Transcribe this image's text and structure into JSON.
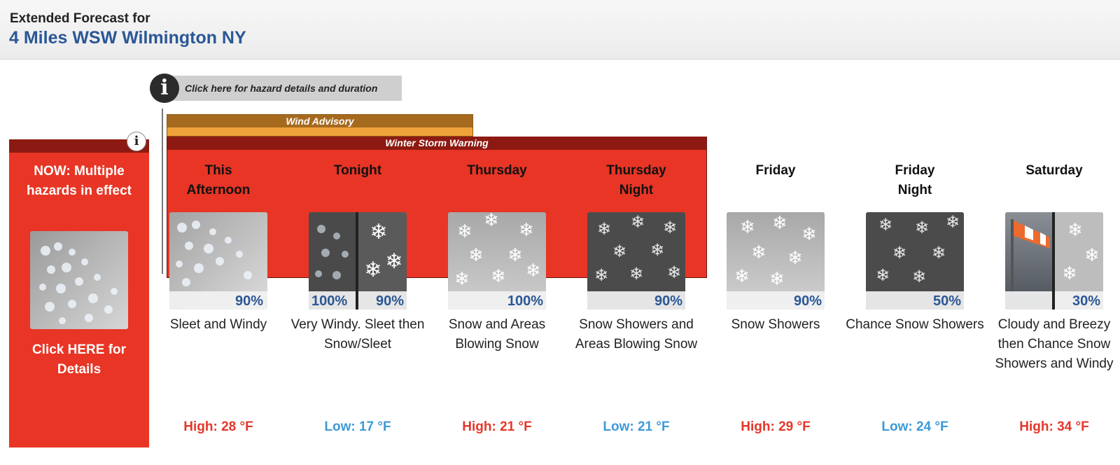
{
  "header": {
    "subtitle": "Extended Forecast for",
    "location": "4 Miles WSW Wilmington NY"
  },
  "hazard_link": {
    "icon": "info-icon",
    "text": "Click here for hazard details and duration"
  },
  "hazards": [
    {
      "name": "Wind Advisory",
      "color": "#f0a23a",
      "label_color": "#a66a1f"
    },
    {
      "name": "Winter Storm Warning",
      "color": "#e83525",
      "label_color": "#8d1a12"
    }
  ],
  "now_box": {
    "icon": "info-icon",
    "text": "NOW: Multiple hazards in effect",
    "link": "Click HERE for Details",
    "image": "sleet-icon"
  },
  "periods": [
    {
      "name": "This Afternoon",
      "pop": [
        "90%"
      ],
      "image": "sleet-icon",
      "description": "Sleet and Windy",
      "temp": "High: 28 °F",
      "type": "high"
    },
    {
      "name": "Tonight",
      "pop": [
        "100%",
        "90%"
      ],
      "image": "sleet-then-snow-icon",
      "description": "Very Windy. Sleet then Snow/Sleet",
      "temp": "Low: 17 °F",
      "type": "low"
    },
    {
      "name": "Thursday",
      "pop": [
        "100%"
      ],
      "image": "snow-icon",
      "description": "Snow and Areas Blowing Snow",
      "temp": "High: 21 °F",
      "type": "high"
    },
    {
      "name": "Thursday Night",
      "pop": [
        "90%"
      ],
      "image": "snow-night-icon",
      "description": "Snow Showers and Areas Blowing Snow",
      "temp": "Low: 21 °F",
      "type": "low"
    },
    {
      "name": "Friday",
      "pop": [
        "90%"
      ],
      "image": "snow-icon",
      "description": "Snow Showers",
      "temp": "High: 29 °F",
      "type": "high"
    },
    {
      "name": "Friday Night",
      "pop": [
        "50%"
      ],
      "image": "snow-night-icon",
      "description": "Chance Snow Showers",
      "temp": "Low: 24 °F",
      "type": "low"
    },
    {
      "name": "Saturday",
      "pop": [
        "30%"
      ],
      "image": "wind-then-snow-icon",
      "description": "Cloudy and Breezy then Chance Snow Showers and Windy",
      "temp": "High: 34 °F",
      "type": "high"
    }
  ],
  "colors": {
    "high": "#e5372a",
    "low": "#3e9ad7",
    "title": "#2b5796",
    "pop": "#2b5796"
  }
}
